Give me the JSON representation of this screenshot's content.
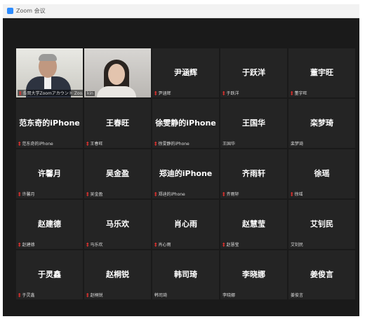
{
  "window": {
    "title": "Zoom 会议"
  },
  "participants": [
    {
      "video": true,
      "label": "長岡大学Zoomアカウント Zoo...",
      "muted": true,
      "kind": "man"
    },
    {
      "video": true,
      "label": "kin",
      "muted": false,
      "kind": "woman"
    },
    {
      "video": false,
      "name": "尹涵辉",
      "label": "尹涵辉",
      "muted": true
    },
    {
      "video": false,
      "name": "于跃洋",
      "label": "于跃洋",
      "muted": true
    },
    {
      "video": false,
      "name": "董宇旺",
      "label": "董宇旺",
      "muted": true
    },
    {
      "video": false,
      "name": "范东奇的iPhone",
      "label": "范东奇的iPhone",
      "muted": true
    },
    {
      "video": false,
      "name": "王春旺",
      "label": "王春旺",
      "muted": true
    },
    {
      "video": false,
      "name": "徐雯静的iPhone",
      "label": "徐雯静的iPhone",
      "muted": true
    },
    {
      "video": false,
      "name": "王国华",
      "label": "王国华",
      "muted": false
    },
    {
      "video": false,
      "name": "栾梦琦",
      "label": "栾梦琦",
      "muted": false
    },
    {
      "video": false,
      "name": "许馨月",
      "label": "许馨月",
      "muted": true
    },
    {
      "video": false,
      "name": "吴金盈",
      "label": "吴金盈",
      "muted": true
    },
    {
      "video": false,
      "name": "郑迪的iPhone",
      "label": "郑迪的iPhone",
      "muted": true
    },
    {
      "video": false,
      "name": "齐雨轩",
      "label": "齐雨轩",
      "muted": true
    },
    {
      "video": false,
      "name": "徐瑶",
      "label": "徐瑶",
      "muted": true
    },
    {
      "video": false,
      "name": "赵建德",
      "label": "赵建德",
      "muted": true
    },
    {
      "video": false,
      "name": "马乐欢",
      "label": "马乐欢",
      "muted": true
    },
    {
      "video": false,
      "name": "肖心雨",
      "label": "肖心雨",
      "muted": true
    },
    {
      "video": false,
      "name": "赵慧莹",
      "label": "赵慧莹",
      "muted": true
    },
    {
      "video": false,
      "name": "艾钊民",
      "label": "艾钊民",
      "muted": false
    },
    {
      "video": false,
      "name": "于灵鑫",
      "label": "于灵鑫",
      "muted": true
    },
    {
      "video": false,
      "name": "赵桐锐",
      "label": "赵桐锐",
      "muted": true
    },
    {
      "video": false,
      "name": "韩司琦",
      "label": "韩司琦",
      "muted": false
    },
    {
      "video": false,
      "name": "李晓娜",
      "label": "李晓娜",
      "muted": false
    },
    {
      "video": false,
      "name": "姜俊言",
      "label": "姜俊言",
      "muted": false
    }
  ],
  "mic_muted_glyph": "‡",
  "colors": {
    "active_speaker": "#c7dc3a",
    "muted_mic": "#e8322f",
    "tile_bg": "#242424",
    "window_bg": "#1a1a1a"
  }
}
